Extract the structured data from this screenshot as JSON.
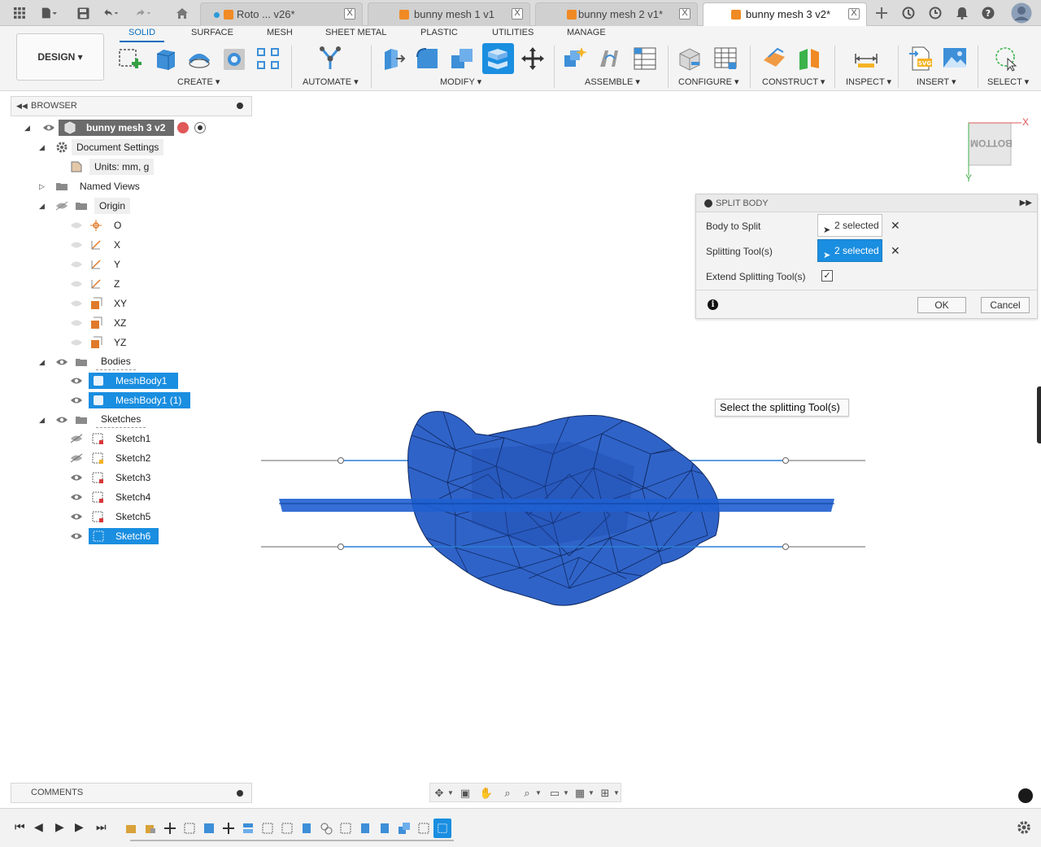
{
  "tabs": [
    {
      "label": "Roto ... v26*",
      "state": "inactive"
    },
    {
      "label": "bunny mesh 1 v1",
      "state": "inactive"
    },
    {
      "label": "bunny mesh 2 v1*",
      "state": "inactive"
    },
    {
      "label": "bunny mesh 3 v2*",
      "state": "active"
    }
  ],
  "tab_close_symbol": "X",
  "ribbon": {
    "workspace_label": "DESIGN ▾",
    "tabs": [
      "SOLID",
      "SURFACE",
      "MESH",
      "SHEET METAL",
      "PLASTIC",
      "UTILITIES",
      "MANAGE"
    ],
    "active_tab": "SOLID",
    "groups": [
      "CREATE ▾",
      "AUTOMATE ▾",
      "MODIFY ▾",
      "ASSEMBLE ▾",
      "CONFIGURE ▾",
      "CONSTRUCT ▾",
      "INSPECT ▾",
      "INSERT ▾",
      "SELECT ▾"
    ]
  },
  "browser": {
    "title": "BROWSER",
    "root": "bunny mesh 3 v2",
    "items": [
      {
        "label": "Document Settings"
      },
      {
        "label": "Units: mm, g"
      },
      {
        "label": "Named Views"
      },
      {
        "label": "Origin"
      },
      {
        "label": "O"
      },
      {
        "label": "X"
      },
      {
        "label": "Y"
      },
      {
        "label": "Z"
      },
      {
        "label": "XY"
      },
      {
        "label": "XZ"
      },
      {
        "label": "YZ"
      },
      {
        "label": "Bodies"
      },
      {
        "label": "MeshBody1"
      },
      {
        "label": "MeshBody1 (1)"
      },
      {
        "label": "Sketches"
      },
      {
        "label": "Sketch1"
      },
      {
        "label": "Sketch2"
      },
      {
        "label": "Sketch3"
      },
      {
        "label": "Sketch4"
      },
      {
        "label": "Sketch5"
      },
      {
        "label": "Sketch6"
      }
    ]
  },
  "viewcube": {
    "face": "BOTTOM",
    "x_axis": "X",
    "y_axis": "Y"
  },
  "split_body": {
    "title": "SPLIT BODY",
    "body_to_split_label": "Body to Split",
    "body_to_split_value": "2 selected",
    "splitting_tools_label": "Splitting Tool(s)",
    "splitting_tools_value": "2 selected",
    "extend_label": "Extend Splitting Tool(s)",
    "extend_checked": "✓",
    "ok": "OK",
    "cancel": "Cancel",
    "clear_symbol": "✕",
    "info_symbol": "i"
  },
  "tooltip": "Select the splitting Tool(s)",
  "comments": {
    "title": "COMMENTS"
  },
  "colors": {
    "accent": "#1a8ee0",
    "mesh_fill": "#2f63c8",
    "mesh_edge": "#10285e",
    "tab_icon": "#f08a24"
  }
}
